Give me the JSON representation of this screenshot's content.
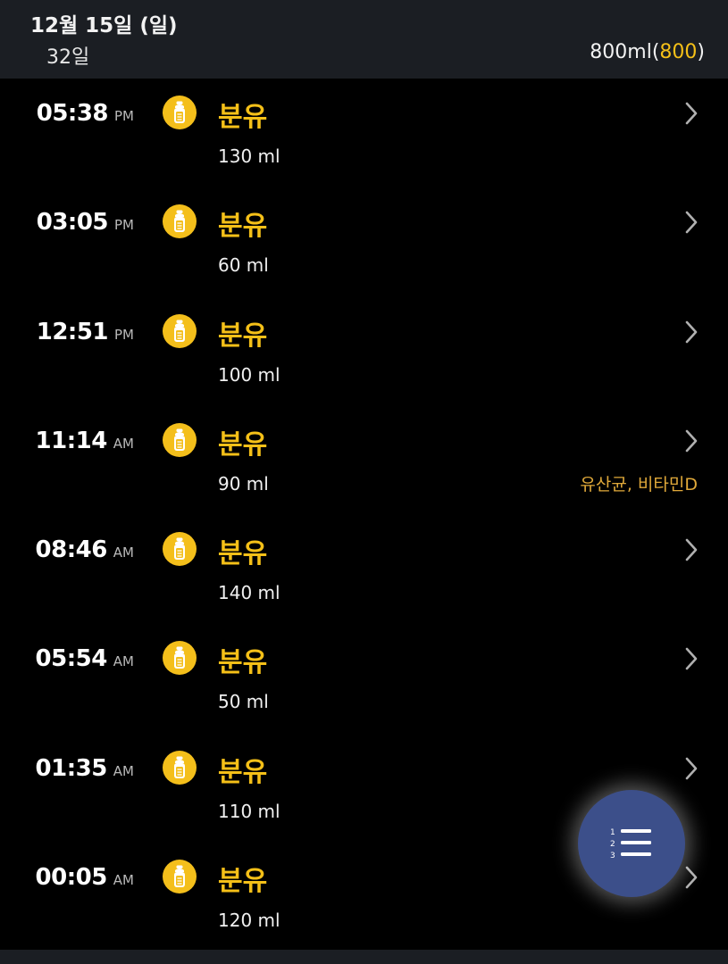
{
  "header": {
    "date": "12월 15일 (일)",
    "day_count": "32일",
    "total": "800ml",
    "total_paren_open": "(",
    "total_target": "800",
    "total_paren_close": ")"
  },
  "entries": [
    {
      "time": "05:38",
      "ampm": "PM",
      "title": "분유",
      "amount": "130 ml",
      "note": ""
    },
    {
      "time": "03:05",
      "ampm": "PM",
      "title": "분유",
      "amount": "60 ml",
      "note": ""
    },
    {
      "time": "12:51",
      "ampm": "PM",
      "title": "분유",
      "amount": "100 ml",
      "note": ""
    },
    {
      "time": "11:14",
      "ampm": "AM",
      "title": "분유",
      "amount": "90 ml",
      "note": "유산균, 비타민D"
    },
    {
      "time": "08:46",
      "ampm": "AM",
      "title": "분유",
      "amount": "140 ml",
      "note": ""
    },
    {
      "time": "05:54",
      "ampm": "AM",
      "title": "분유",
      "amount": "50 ml",
      "note": ""
    },
    {
      "time": "01:35",
      "ampm": "AM",
      "title": "분유",
      "amount": "110 ml",
      "note": ""
    },
    {
      "time": "00:05",
      "ampm": "AM",
      "title": "분유",
      "amount": "120 ml",
      "note": ""
    }
  ],
  "icons": {
    "entry": "baby-bottle-icon",
    "row_action": "chevron-right-icon",
    "fab": "numbered-list-icon"
  },
  "colors": {
    "accent": "#f5c018",
    "note": "#e0a93a",
    "header_bg": "#1b1e23",
    "fab_bg": "#3c4f8a"
  }
}
